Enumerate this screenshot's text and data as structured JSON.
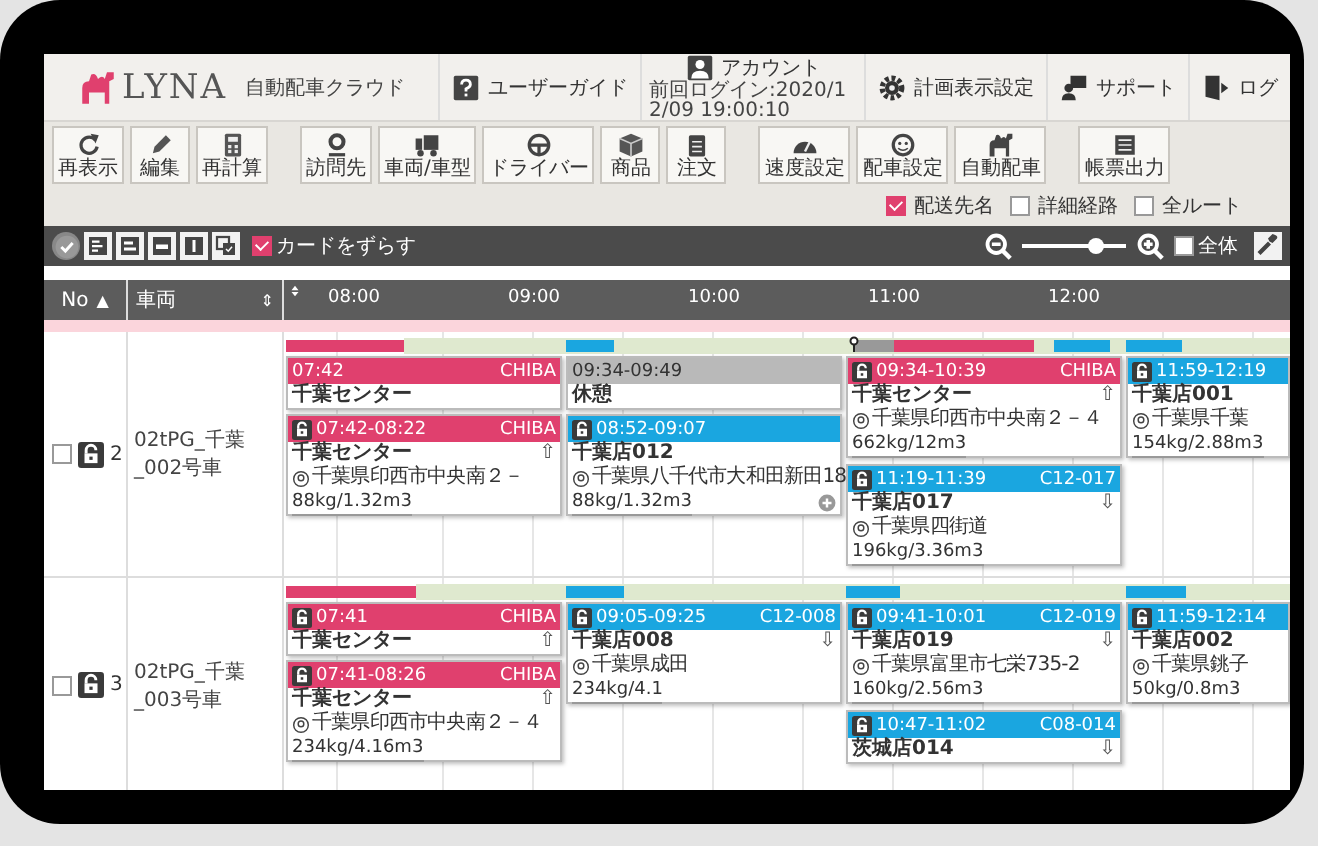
{
  "app": {
    "logo": "LYNA",
    "product": "自動配車クラウド"
  },
  "nav": [
    {
      "label": "ユーザーガイド"
    },
    {
      "label": "アカウント",
      "sublabel": "前回ログイン:2020/12/09 19:00:10"
    },
    {
      "label": "計画表示設定"
    },
    {
      "label": "サポート"
    },
    {
      "label": "ログ"
    }
  ],
  "toolbar_groups": [
    [
      "再表示",
      "編集",
      "再計算"
    ],
    [
      "訪問先",
      "車両/車型",
      "ドライバー",
      "商品",
      "注文"
    ],
    [
      "速度設定",
      "配車設定",
      "自動配車"
    ],
    [
      "帳票出力"
    ]
  ],
  "display_options": [
    {
      "label": "配送先名",
      "checked": true
    },
    {
      "label": "詳細経路",
      "checked": false
    },
    {
      "label": "全ルート",
      "checked": false
    }
  ],
  "view_bar": {
    "shift_cards": {
      "label": "カードをずらす",
      "checked": true
    },
    "zoom": {
      "level": 0.72
    },
    "show_all": {
      "label": "全体",
      "checked": false
    }
  },
  "table": {
    "columns": [
      {
        "label": "No",
        "sort": "▲"
      },
      {
        "label": "車両",
        "sort": "⇕"
      }
    ],
    "hours": [
      "08:00",
      "09:00",
      "10:00",
      "11:00",
      "12:00"
    ],
    "rows": [
      {
        "checked": false,
        "padlock": true,
        "no": "2",
        "vehicle": "02tPG_千葉_002号車",
        "cards": [
          {
            "kind": "depot",
            "padlock": false,
            "time": "07:42",
            "code": "CHIBA",
            "name": "千葉センター"
          },
          {
            "kind": "depot",
            "padlock": true,
            "time": "07:42-08:22",
            "code": "CHIBA",
            "name": "千葉センター",
            "arrow": "⇧",
            "address": "千葉県印西市中央南２－",
            "load": "88kg/1.32m3"
          },
          {
            "kind": "break",
            "padlock": false,
            "time": "09:34-09:49",
            "name": "休憩"
          },
          {
            "kind": "store",
            "padlock": true,
            "time": "08:52-09:07",
            "name": "千葉店012",
            "address": "千葉県八千代市大和田新田18",
            "load": "88kg/1.32m3",
            "more": true
          },
          {
            "kind": "depot",
            "padlock": true,
            "time": "09:34-10:39",
            "code": "CHIBA",
            "name": "千葉センター",
            "arrow": "⇧",
            "address": "千葉県印西市中央南２－４",
            "load": "662kg/12m3"
          },
          {
            "kind": "store",
            "padlock": true,
            "time": "11:19-11:39",
            "code": "C12-017",
            "name": "千葉店017",
            "arrow": "⇩",
            "address": "千葉県四街道",
            "load": "196kg/3.36m3"
          },
          {
            "kind": "store",
            "padlock": true,
            "time": "11:59-12:19",
            "name": "千葉店001",
            "address": "千葉県千葉",
            "load": "154kg/2.88m3"
          }
        ]
      },
      {
        "checked": false,
        "padlock": true,
        "no": "3",
        "vehicle": "02tPG_千葉_003号車",
        "cards": [
          {
            "kind": "depot",
            "padlock": true,
            "time": "07:41",
            "code": "CHIBA",
            "name": "千葉センター",
            "arrow": "⇧"
          },
          {
            "kind": "depot",
            "padlock": true,
            "time": "07:41-08:26",
            "code": "CHIBA",
            "name": "千葉センター",
            "arrow": "⇧",
            "address": "千葉県印西市中央南２－４",
            "load": "234kg/4.16m3"
          },
          {
            "kind": "store",
            "padlock": true,
            "time": "09:05-09:25",
            "code": "C12-008",
            "name": "千葉店008",
            "arrow": "⇩",
            "address": "千葉県成田",
            "load": "234kg/4.1"
          },
          {
            "kind": "store",
            "padlock": true,
            "time": "09:41-10:01",
            "code": "C12-019",
            "name": "千葉店019",
            "arrow": "⇩",
            "address": "千葉県富里市七栄735-2",
            "load": "160kg/2.56m3"
          },
          {
            "kind": "store",
            "padlock": true,
            "time": "10:47-11:02",
            "code": "C08-014",
            "name": "茨城店014",
            "arrow": "⇩"
          },
          {
            "kind": "store",
            "padlock": true,
            "time": "11:59-12:14",
            "name": "千葉店002",
            "address": "千葉県銚子",
            "load": "50kg/0.8m3"
          }
        ]
      }
    ]
  }
}
